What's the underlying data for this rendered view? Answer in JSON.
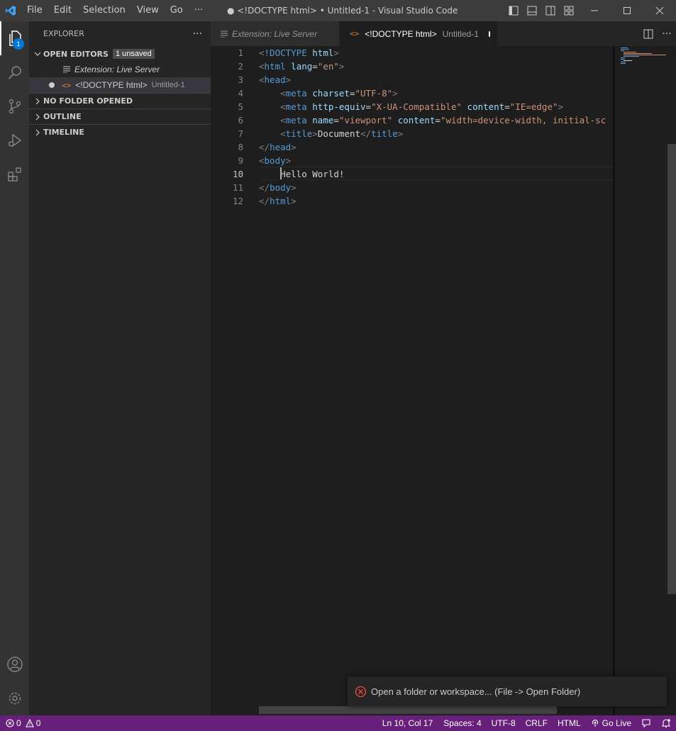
{
  "window": {
    "title": "● <!DOCTYPE html> • Untitled-1 - Visual Studio Code",
    "menu": [
      "File",
      "Edit",
      "Selection",
      "View",
      "Go",
      "···"
    ]
  },
  "activity_bar": {
    "explorer_badge": "1",
    "icons": [
      "files-icon",
      "search-icon",
      "source-control-icon",
      "run-debug-icon",
      "extensions-icon",
      "account-icon",
      "manage-gear-icon"
    ]
  },
  "sidebar": {
    "title": "EXPLORER",
    "more": "···",
    "open_editors": {
      "label": "OPEN EDITORS",
      "badge": "1 unsaved",
      "items": [
        {
          "label": "Extension: Live Server",
          "desc": ""
        },
        {
          "label": "<!DOCTYPE html>",
          "desc": "Untitled-1"
        }
      ]
    },
    "sections": [
      "NO FOLDER OPENED",
      "OUTLINE",
      "TIMELINE"
    ]
  },
  "tabs": [
    {
      "label": "Extension: Live Server",
      "desc": ""
    },
    {
      "label": "<!DOCTYPE html>",
      "desc": "Untitled-1"
    }
  ],
  "editor": {
    "line_numbers": [
      "1",
      "2",
      "3",
      "4",
      "5",
      "6",
      "7",
      "8",
      "9",
      "10",
      "11",
      "12"
    ],
    "current_line": 10,
    "lines": [
      [
        [
          "pun",
          "<"
        ],
        [
          "tag",
          "!DOCTYPE"
        ],
        [
          "txt",
          " "
        ],
        [
          "attr",
          "html"
        ],
        [
          "pun",
          ">"
        ]
      ],
      [
        [
          "pun",
          "<"
        ],
        [
          "tag",
          "html"
        ],
        [
          "txt",
          " "
        ],
        [
          "attr",
          "lang"
        ],
        [
          "txt",
          "="
        ],
        [
          "str",
          "\"en\""
        ],
        [
          "pun",
          ">"
        ]
      ],
      [
        [
          "pun",
          "<"
        ],
        [
          "tag",
          "head"
        ],
        [
          "pun",
          ">"
        ]
      ],
      [
        [
          "txt",
          "    "
        ],
        [
          "pun",
          "<"
        ],
        [
          "tag",
          "meta"
        ],
        [
          "txt",
          " "
        ],
        [
          "attr",
          "charset"
        ],
        [
          "txt",
          "="
        ],
        [
          "str",
          "\"UTF-8\""
        ],
        [
          "pun",
          ">"
        ]
      ],
      [
        [
          "txt",
          "    "
        ],
        [
          "pun",
          "<"
        ],
        [
          "tag",
          "meta"
        ],
        [
          "txt",
          " "
        ],
        [
          "attr",
          "http-equiv"
        ],
        [
          "txt",
          "="
        ],
        [
          "str",
          "\"X-UA-Compatible\""
        ],
        [
          "txt",
          " "
        ],
        [
          "attr",
          "content"
        ],
        [
          "txt",
          "="
        ],
        [
          "str",
          "\"IE=edge\""
        ],
        [
          "pun",
          ">"
        ]
      ],
      [
        [
          "txt",
          "    "
        ],
        [
          "pun",
          "<"
        ],
        [
          "tag",
          "meta"
        ],
        [
          "txt",
          " "
        ],
        [
          "attr",
          "name"
        ],
        [
          "txt",
          "="
        ],
        [
          "str",
          "\"viewport\""
        ],
        [
          "txt",
          " "
        ],
        [
          "attr",
          "content"
        ],
        [
          "txt",
          "="
        ],
        [
          "str",
          "\"width=device-width, initial-sc"
        ]
      ],
      [
        [
          "txt",
          "    "
        ],
        [
          "pun",
          "<"
        ],
        [
          "tag",
          "title"
        ],
        [
          "pun",
          ">"
        ],
        [
          "txt",
          "Document"
        ],
        [
          "pun",
          "</"
        ],
        [
          "tag",
          "title"
        ],
        [
          "pun",
          ">"
        ]
      ],
      [
        [
          "pun",
          "</"
        ],
        [
          "tag",
          "head"
        ],
        [
          "pun",
          ">"
        ]
      ],
      [
        [
          "pun",
          "<"
        ],
        [
          "tag",
          "body"
        ],
        [
          "pun",
          ">"
        ]
      ],
      [
        [
          "txt",
          "    Hello World!"
        ]
      ],
      [
        [
          "pun",
          "</"
        ],
        [
          "tag",
          "body"
        ],
        [
          "pun",
          ">"
        ]
      ],
      [
        [
          "pun",
          "</"
        ],
        [
          "tag",
          "html"
        ],
        [
          "pun",
          ">"
        ]
      ]
    ]
  },
  "notification": {
    "message": "Open a folder or workspace... (File -> Open Folder)"
  },
  "status_bar": {
    "errors": "0",
    "warnings": "0",
    "position": "Ln 10, Col 17",
    "spaces": "Spaces: 4",
    "encoding": "UTF-8",
    "eol": "CRLF",
    "language": "HTML",
    "go_live": "Go Live"
  },
  "colors": {
    "status_bar": "#68217a",
    "badge": "#0078d4",
    "tag": "#569cd6",
    "attr": "#9cdcfe",
    "string": "#ce9178",
    "error": "#f14c4c"
  }
}
